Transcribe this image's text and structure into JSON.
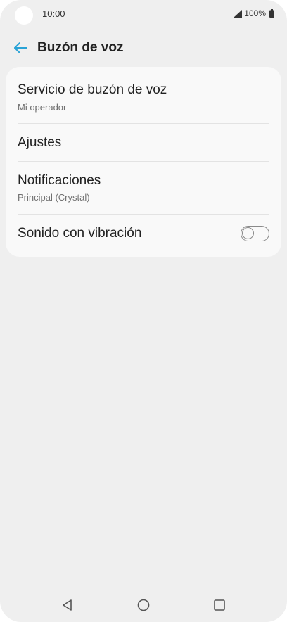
{
  "status_bar": {
    "time": "10:00",
    "battery": "100%"
  },
  "header": {
    "title": "Buzón de voz",
    "back_icon": "arrow-left-icon",
    "accent_color": "#2aa3d6"
  },
  "settings": {
    "items": [
      {
        "title": "Servicio de buzón de voz",
        "subtitle": "Mi operador"
      },
      {
        "title": "Ajustes"
      },
      {
        "title": "Notificaciones",
        "subtitle": "Principal (Crystal)"
      },
      {
        "title": "Sonido con vibración",
        "toggle_on": false
      }
    ]
  },
  "nav_bar": {
    "icons": [
      "back-triangle-icon",
      "home-circle-icon",
      "recents-square-icon"
    ]
  }
}
